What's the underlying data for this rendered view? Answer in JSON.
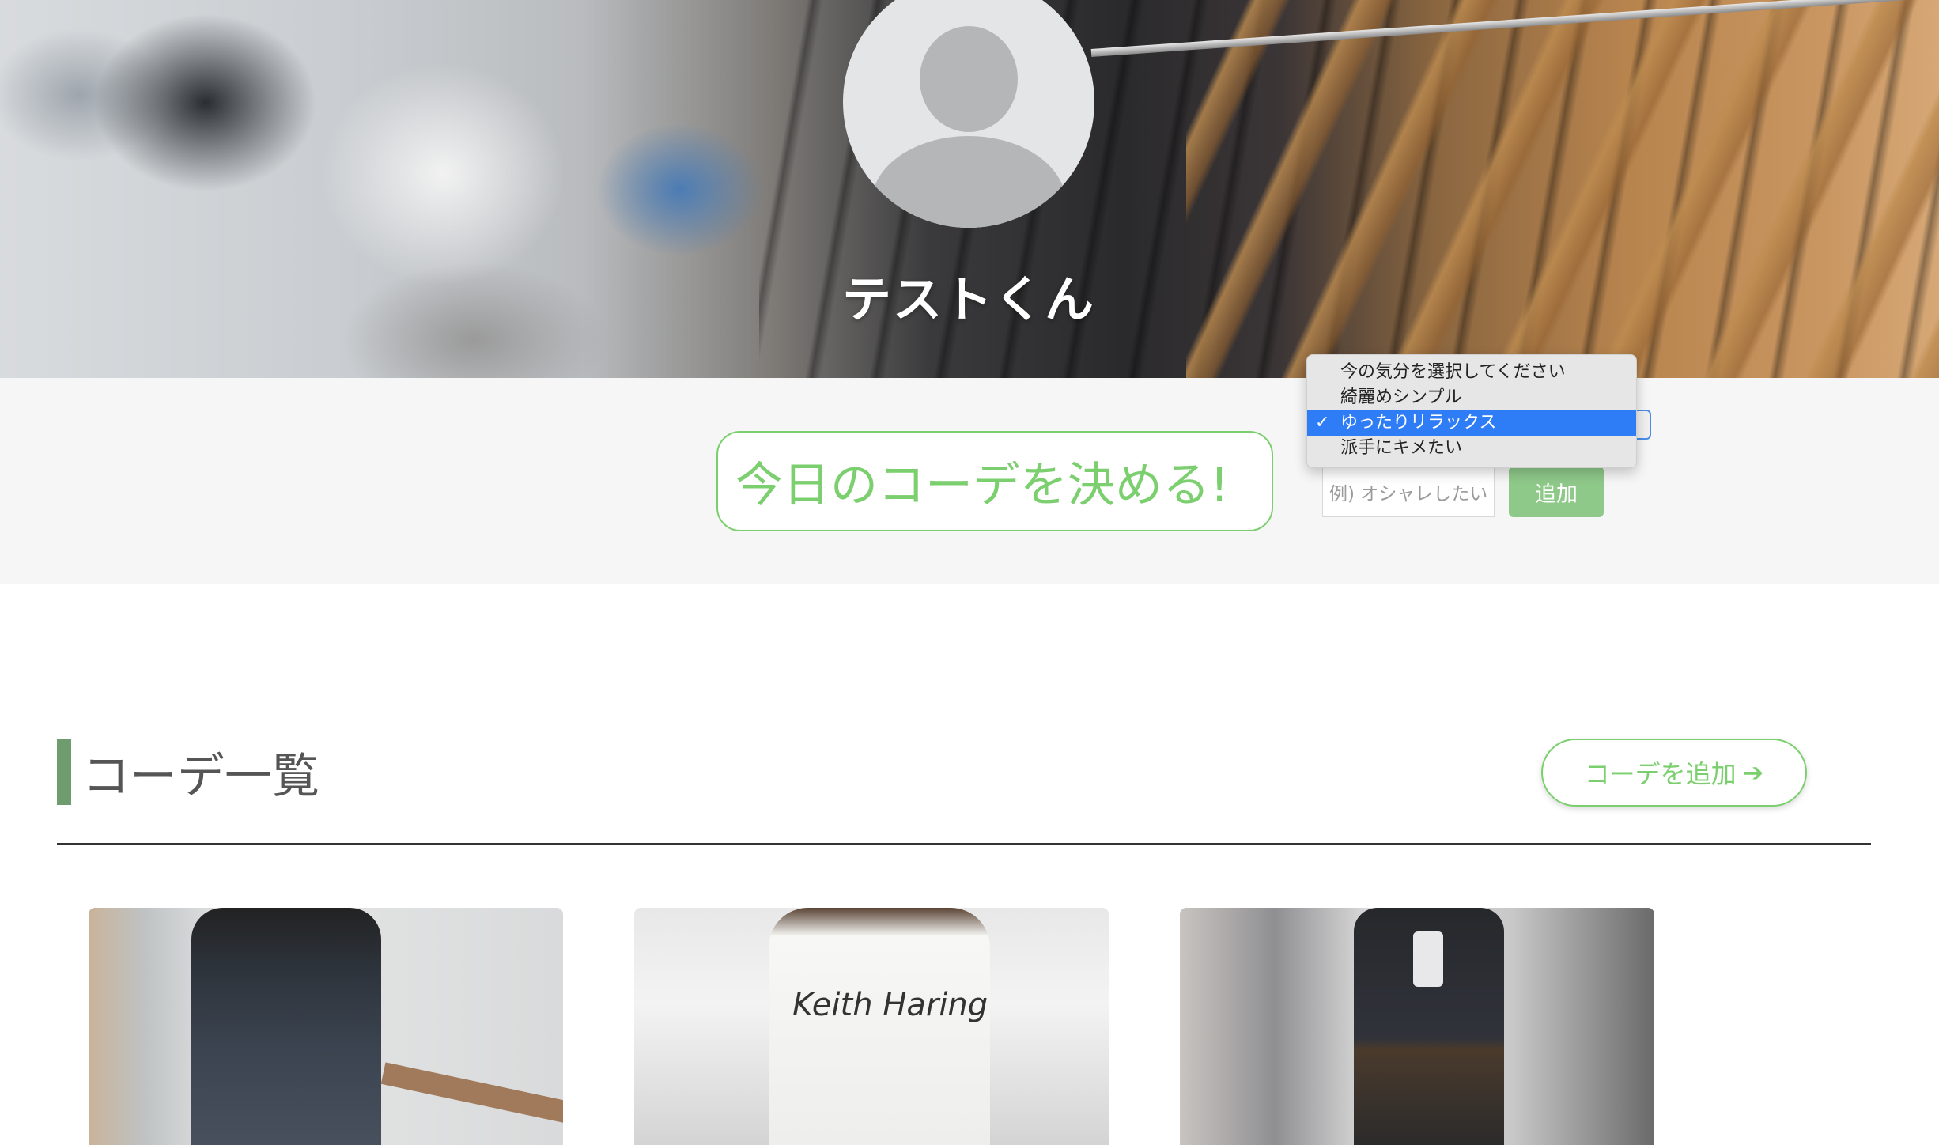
{
  "profile": {
    "username": "テストくん"
  },
  "mood": {
    "decide_button": "今日のコーデを決める!",
    "input_placeholder": "例) オシャレしたい",
    "add_button": "追加",
    "options": [
      {
        "label": "今の気分を選択してください",
        "selected": false
      },
      {
        "label": "綺麗めシンプル",
        "selected": false
      },
      {
        "label": "ゆったりリラックス",
        "selected": true
      },
      {
        "label": "派手にキメたい",
        "selected": false
      }
    ],
    "check_mark": "✓"
  },
  "coordinates": {
    "section_title": "コーデ一覧",
    "add_button": "コーデを追加",
    "add_arrow": "➔",
    "cards": [
      {
        "image": "outfit-photo-1"
      },
      {
        "image": "outfit-photo-2",
        "print_text": "Keith Haring"
      },
      {
        "image": "outfit-photo-3"
      }
    ]
  },
  "colors": {
    "accent_green": "#7ccf6e",
    "button_green": "#8fc98a",
    "section_bar": "#6f9c6e",
    "selected_option": "#2e7cf6"
  }
}
